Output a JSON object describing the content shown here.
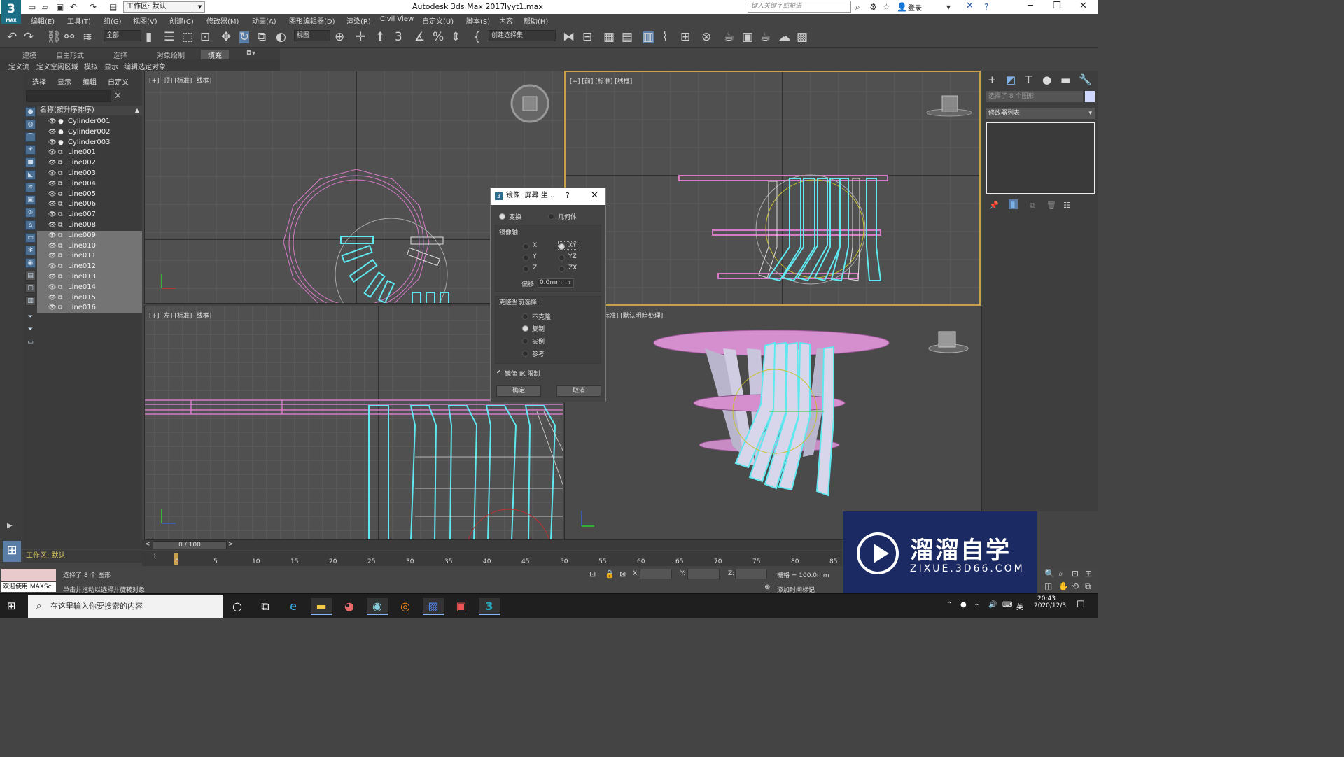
{
  "titlebar": {
    "app_title": "Autodesk 3ds Max 2017",
    "file_name": "lyyt1.max",
    "workspace": "工作区: 默认",
    "search_placeholder": "键入关键字或短语",
    "login": "登录",
    "logo": "3",
    "logo_sub": "MAX"
  },
  "menu": [
    "编辑(E)",
    "工具(T)",
    "组(G)",
    "视图(V)",
    "创建(C)",
    "修改器(M)",
    "动画(A)",
    "图形编辑器(D)",
    "渲染(R)",
    "Civil View",
    "自定义(U)",
    "脚本(S)",
    "内容",
    "帮助(H)"
  ],
  "toolbar": {
    "filter_select": "全部",
    "coord_select": "视图",
    "selection_set": "创建选择集"
  },
  "ribbon": {
    "tabs": [
      "建模",
      "自由形式",
      "选择",
      "对象绘制",
      "填充"
    ],
    "active_tab": "填充",
    "row2": [
      "定义流",
      "定义空闲区域",
      "模拟",
      "显示",
      "编辑选定对象"
    ]
  },
  "scene_explorer": {
    "tabs": [
      "选择",
      "显示",
      "编辑",
      "自定义"
    ],
    "column_header": "名称(按升序排序)",
    "items": [
      {
        "name": "Cylinder001",
        "selected": false
      },
      {
        "name": "Cylinder002",
        "selected": false
      },
      {
        "name": "Cylinder003",
        "selected": false
      },
      {
        "name": "Line001",
        "selected": false
      },
      {
        "name": "Line002",
        "selected": false
      },
      {
        "name": "Line003",
        "selected": false
      },
      {
        "name": "Line004",
        "selected": false
      },
      {
        "name": "Line005",
        "selected": false
      },
      {
        "name": "Line006",
        "selected": false
      },
      {
        "name": "Line007",
        "selected": false
      },
      {
        "name": "Line008",
        "selected": false
      },
      {
        "name": "Line009",
        "selected": true
      },
      {
        "name": "Line010",
        "selected": true
      },
      {
        "name": "Line011",
        "selected": true
      },
      {
        "name": "Line012",
        "selected": true
      },
      {
        "name": "Line013",
        "selected": true
      },
      {
        "name": "Line014",
        "selected": true
      },
      {
        "name": "Line015",
        "selected": true
      },
      {
        "name": "Line016",
        "selected": true
      }
    ],
    "workspace": "工作区: 默认"
  },
  "viewports": {
    "top": "[+] [顶] [标准] [线框]",
    "front": "[+] [前] [标准] [线框]",
    "left": "[+] [左] [标准] [线框]",
    "persp": "[+] [透视] [标准] [默认明暗处理]"
  },
  "command_panel": {
    "selection_name": "选择了 8 个图形",
    "modifier_list": "修改器列表"
  },
  "dialog": {
    "title": "镜像: 屏幕 坐...",
    "mode_options": [
      "变换",
      "几何体"
    ],
    "mode_selected": "变换",
    "axis_label": "镜像轴:",
    "axes": [
      "X",
      "Y",
      "Z",
      "XY",
      "YZ",
      "ZX"
    ],
    "axis_selected": "XY",
    "offset_label": "偏移:",
    "offset_value": "0.0mm",
    "clone_label": "克隆当前选择:",
    "clone_options": [
      "不克隆",
      "复制",
      "实例",
      "参考"
    ],
    "clone_selected": "复制",
    "mirror_ik": "镜像 IK 限制",
    "mirror_ik_checked": true,
    "ok": "确定",
    "cancel": "取消"
  },
  "timeline": {
    "frame": "0 / 100",
    "ticks": [
      "0",
      "5",
      "10",
      "15",
      "20",
      "25",
      "30",
      "35",
      "40",
      "45",
      "50",
      "55",
      "60",
      "65",
      "70",
      "75",
      "80",
      "85"
    ]
  },
  "status": {
    "selected": "选择了 8 个 图形",
    "prompt": "单击并拖动以选择并旋转对象",
    "welcome": "欢迎使用 MAXSc",
    "x_label": "X:",
    "y_label": "Y:",
    "z_label": "Z:",
    "grid": "栅格 = 100.0mm",
    "add_time_tag": "添加时间标记"
  },
  "taskbar": {
    "search": "在这里输入你要搜索的内容",
    "time": "20:43",
    "date": "2020/12/3",
    "ime": "英"
  },
  "watermark": {
    "title": "溜溜自学",
    "url": "ZIXUE.3D66.COM"
  },
  "colors": {
    "viewport_bg": "#505050",
    "selection_cyan": "#5fe8f0",
    "pink_object": "#d67ac9",
    "active_border": "#c8a04a"
  }
}
